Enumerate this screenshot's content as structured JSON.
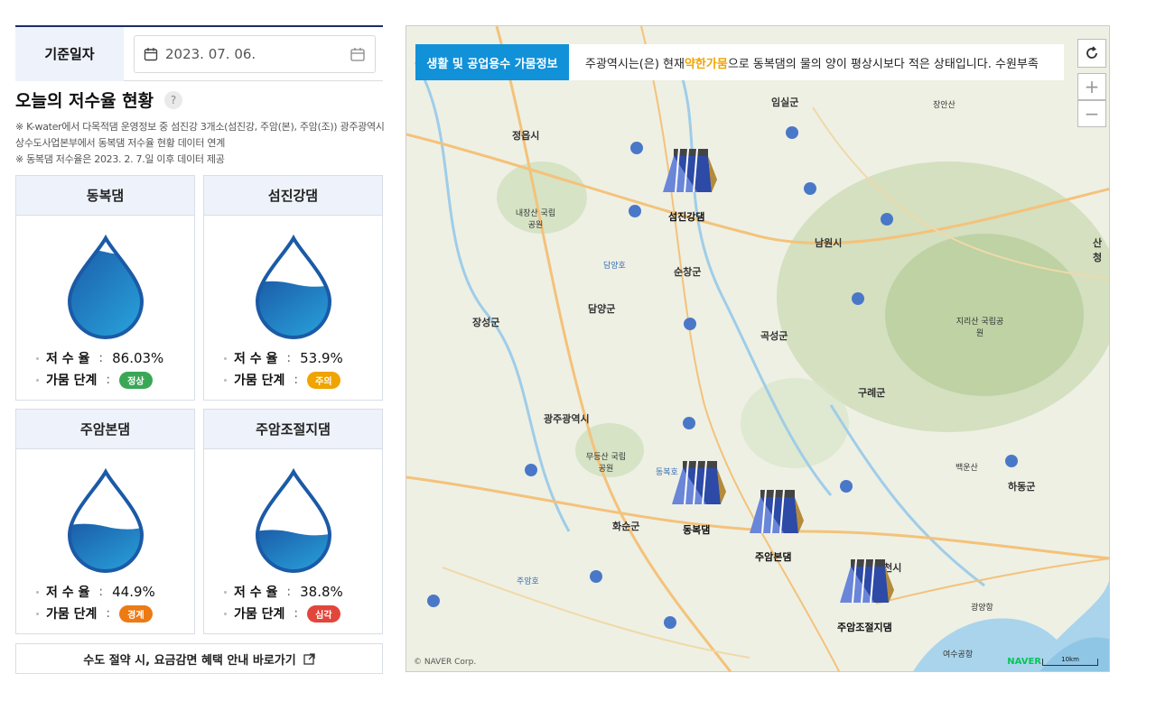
{
  "filter": {
    "date_label": "기준일자",
    "date_value": "2023. 07. 06."
  },
  "section": {
    "title": "오늘의 저수율 현황",
    "help": "?",
    "note1": "※ K-water에서 다목적댐 운영정보 중 섬진강 3개소(섬진강, 주암(본), 주암(조)) 광주광역시상수도사업본부에서 동복댐 저수율 현황 데이터 연계",
    "note2": "※ 동복댐 저수율은 2023. 2. 7.일 이후 데이터 제공"
  },
  "labels": {
    "rate": "저 수 율",
    "stage": "가뭄 단계",
    "colon": ":"
  },
  "dams": [
    {
      "name": "동복댐",
      "rate": "86.03%",
      "level": 0.8603,
      "stage": "정상",
      "color": "#3aa757"
    },
    {
      "name": "섬진강댐",
      "rate": "53.9%",
      "level": 0.539,
      "stage": "주의",
      "color": "#f0a400"
    },
    {
      "name": "주암본댐",
      "rate": "44.9%",
      "level": 0.449,
      "stage": "경계",
      "color": "#ec7a15"
    },
    {
      "name": "주암조절지댐",
      "rate": "38.8%",
      "level": 0.388,
      "stage": "심각",
      "color": "#e2463b"
    }
  ],
  "link": {
    "label": "수도 절약 시, 요금감면 혜택 안내 바로가기",
    "icon": "external-link-icon"
  },
  "map": {
    "tab_label": "생활 및 공업용수 가뭄정보",
    "msg_pre": "주광역시는(은) 현재 ",
    "msg_highlight": "약한가뭄",
    "msg_post": "으로 동복댐의 물의 양이 평상시보다 적은 상태입니다. 수원부족",
    "refresh_icon": "refresh-icon",
    "zoom_in": "+",
    "zoom_out": "−",
    "dam_labels": [
      "섬진강댐",
      "동복댐",
      "주암본댐",
      "주암조절지댐"
    ],
    "places": [
      "임실군",
      "정읍시",
      "남원시",
      "순창군",
      "담양군",
      "장성군",
      "곡성군",
      "구례군",
      "광주광역시",
      "화순군",
      "하동군",
      "순천시",
      "내장산 국립공원",
      "지리산 국립공원",
      "무등산 국립공원",
      "담양호",
      "동복호",
      "주암호",
      "광양항",
      "여수공항",
      "산청",
      "백운산",
      "장안산"
    ],
    "copyright": "© NAVER Corp.",
    "brand": "NAVER",
    "scale": "10km"
  },
  "colors": {
    "accent": "#1191d8",
    "header_bg": "#eef3fb",
    "water_dark": "#1b5aa6",
    "water_light": "#29a9e1"
  }
}
